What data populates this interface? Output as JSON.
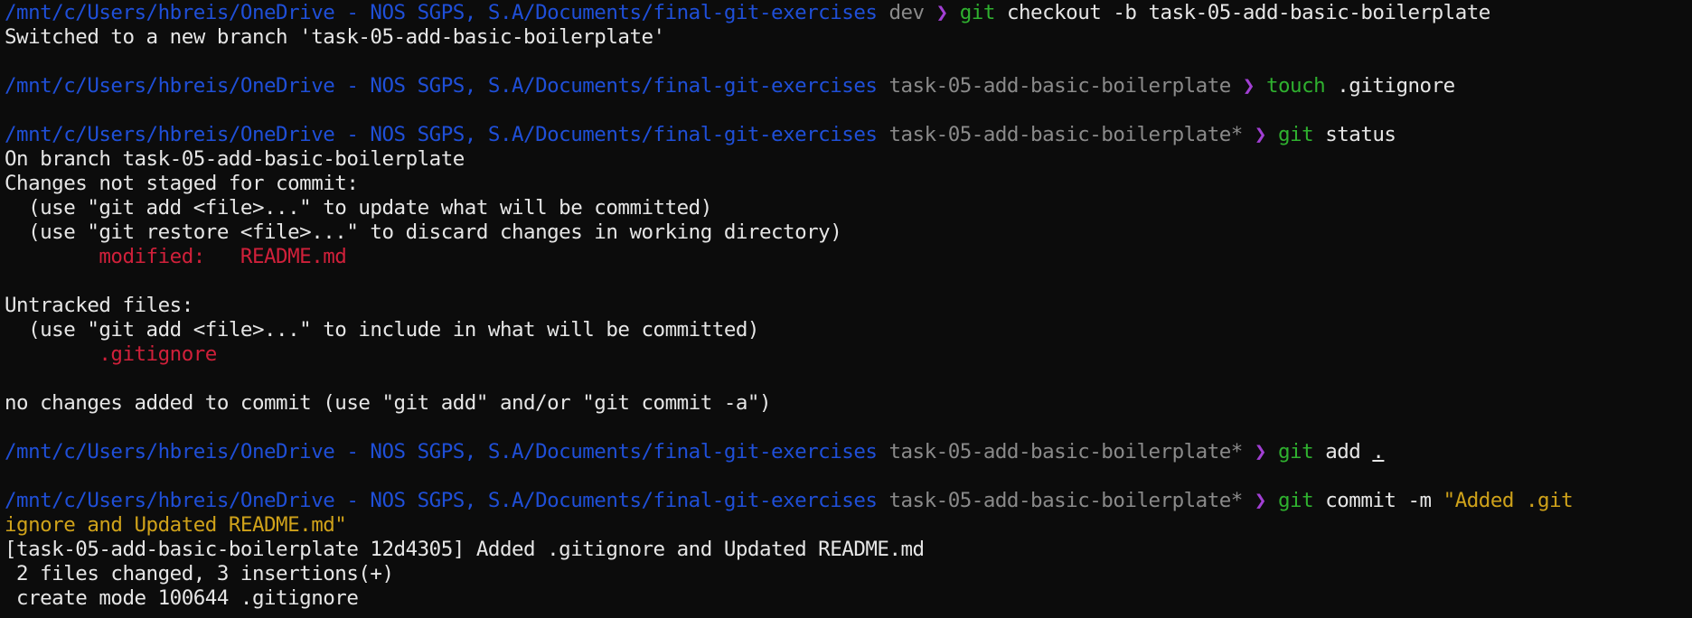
{
  "prompt": {
    "path": "/mnt/c/Users/hbreis/OneDrive - NOS SGPS, S.A/Documents/final-git-exercises",
    "arrow": "❯"
  },
  "blocks": [
    {
      "branch": "dev",
      "cmd": "git",
      "args": "checkout -b task-05-add-basic-boilerplate",
      "output": [
        "Switched to a new branch 'task-05-add-basic-boilerplate'"
      ]
    },
    {
      "branch": "task-05-add-basic-boilerplate",
      "cmd": "touch",
      "args": ".gitignore"
    },
    {
      "branch": "task-05-add-basic-boilerplate*",
      "cmd": "git",
      "args": "status",
      "output": [
        "On branch task-05-add-basic-boilerplate",
        "Changes not staged for commit:",
        "  (use \"git add <file>...\" to update what will be committed)",
        "  (use \"git restore <file>...\" to discard changes in working directory)"
      ],
      "modified": "        modified:   README.md",
      "untracked_header": "Untracked files:",
      "untracked_hint": "  (use \"git add <file>...\" to include in what will be committed)",
      "untracked_file": "        .gitignore",
      "footer": "no changes added to commit (use \"git add\" and/or \"git commit -a\")"
    },
    {
      "branch": "task-05-add-basic-boilerplate*",
      "cmd": "git",
      "args": "add ",
      "args_underlined": "."
    },
    {
      "branch": "task-05-add-basic-boilerplate*",
      "cmd": "git",
      "args": "commit -m ",
      "message_part1": "\"Added .git",
      "message_part2": "ignore and Updated README.md\"",
      "output": [
        "[task-05-add-basic-boilerplate 12d4305] Added .gitignore and Updated README.md",
        " 2 files changed, 3 insertions(+)",
        " create mode 100644 .gitignore"
      ]
    }
  ],
  "colors": {
    "background": "#0c0c0c",
    "path": "#1f4fd8",
    "branch": "#8a8a8a",
    "arrow": "#a23fd4",
    "command": "#2fb12f",
    "string": "#cfa21a",
    "error_red": "#d0203a",
    "text": "#e6e6e6"
  }
}
